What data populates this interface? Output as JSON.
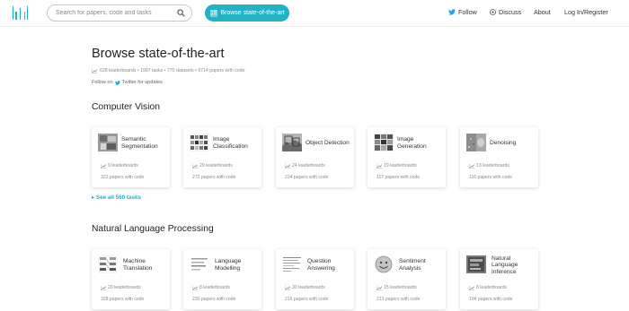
{
  "navbar": {
    "search_placeholder": "Search for papers, code and tasks",
    "browse_label": "Browse state-of-the-art",
    "links": [
      "Follow",
      "Discuss",
      "About",
      "Log In/Register"
    ]
  },
  "colors": {
    "accent": "#21b2c5",
    "text": "#333333",
    "muted": "#8a8a8a"
  },
  "header": {
    "title": "Browse state-of-the-art",
    "stats": "628 leaderboards • 1997 tasks • 770 datasets • 9714 papers with code",
    "follow_prefix": "Follow on",
    "follow_suffix": "Twitter for updates"
  },
  "sections": [
    {
      "title": "Computer Vision",
      "see_all": "See all 560 tasks",
      "cards": [
        {
          "name": "Semantic Segmentation",
          "leaderboards": "9 leaderboards",
          "papers": "322 papers with code",
          "icon": "segmentation-thumbnail"
        },
        {
          "name": "Image Classification",
          "leaderboards": "29 leaderboards",
          "papers": "272 papers with code",
          "icon": "classification-thumbnail"
        },
        {
          "name": "Object Detection",
          "leaderboards": "24 leaderboards",
          "papers": "234 papers with code",
          "icon": "detection-thumbnail"
        },
        {
          "name": "Image Generation",
          "leaderboards": "19 leaderboards",
          "papers": "117 papers with code",
          "icon": "generation-thumbnail"
        },
        {
          "name": "Denoising",
          "leaderboards": "13 leaderboards",
          "papers": "116 papers with code",
          "icon": "denoising-thumbnail"
        }
      ]
    },
    {
      "title": "Natural Language Processing",
      "cards": [
        {
          "name": "Machine Translation",
          "leaderboards": "20 leaderboards",
          "papers": "328 papers with code",
          "icon": "translation-thumbnail"
        },
        {
          "name": "Language Modelling",
          "leaderboards": "8 leaderboards",
          "papers": "230 papers with code",
          "icon": "language-modelling-thumbnail"
        },
        {
          "name": "Question Answering",
          "leaderboards": "30 leaderboards",
          "papers": "216 papers with code",
          "icon": "qa-thumbnail"
        },
        {
          "name": "Sentiment Analysis",
          "leaderboards": "15 leaderboards",
          "papers": "213 papers with code",
          "icon": "sentiment-thumbnail"
        },
        {
          "name": "Natural Language Inference",
          "leaderboards": "8 leaderboards",
          "papers": "104 papers with code",
          "icon": "nli-thumbnail"
        }
      ]
    }
  ]
}
